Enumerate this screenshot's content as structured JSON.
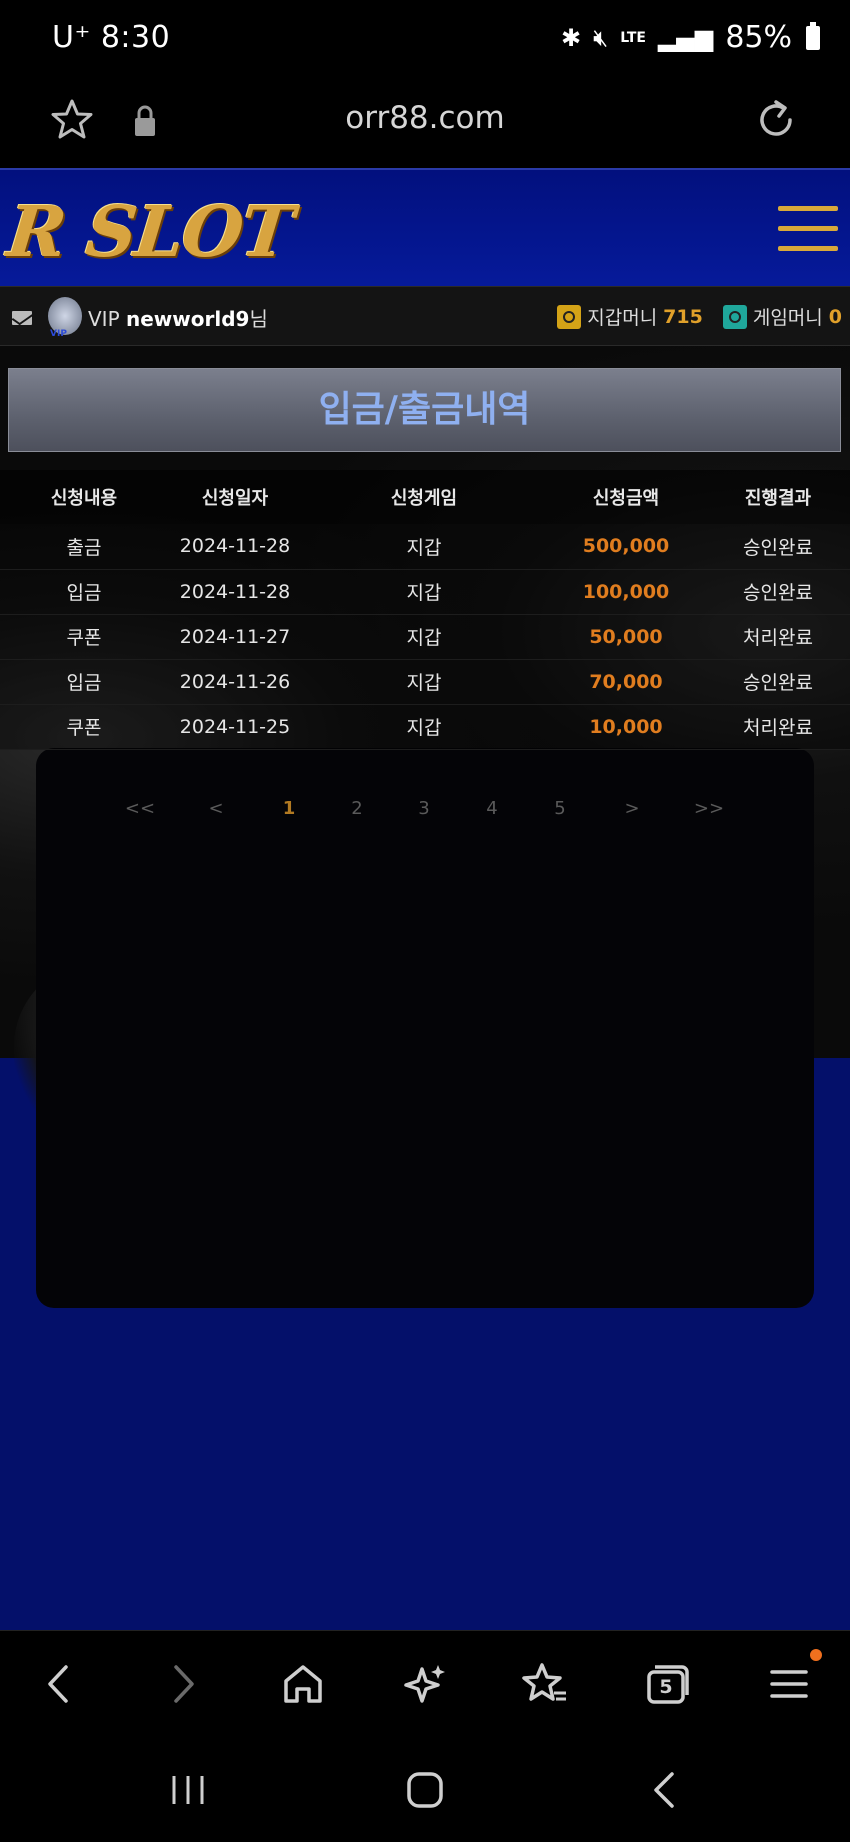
{
  "status_bar": {
    "carrier_time": "U⁺ 8:30",
    "network": "LTE",
    "battery": "85%"
  },
  "browser": {
    "url": "orr88.com",
    "tab_count": "5"
  },
  "site": {
    "logo": "R SLOT",
    "user": {
      "level": "VIP",
      "username": "newworld9",
      "suffix": "님",
      "wallet_label": "지갑머니",
      "wallet_amount": "715",
      "game_label": "게임머니",
      "game_amount": "0"
    },
    "page_title": "입금/출금내역",
    "table": {
      "headers": [
        "신청내용",
        "신청일자",
        "신청게임",
        "신청금액",
        "진행결과"
      ],
      "rows": [
        [
          "출금",
          "2024-11-28",
          "지갑",
          "500,000",
          "승인완료"
        ],
        [
          "입금",
          "2024-11-28",
          "지갑",
          "100,000",
          "승인완료"
        ],
        [
          "쿠폰",
          "2024-11-27",
          "지갑",
          "50,000",
          "처리완료"
        ],
        [
          "입금",
          "2024-11-26",
          "지갑",
          "70,000",
          "승인완료"
        ],
        [
          "쿠폰",
          "2024-11-25",
          "지갑",
          "10,000",
          "처리완료"
        ]
      ]
    },
    "pagination": {
      "first": "<<",
      "prev": "<",
      "pages": [
        "1",
        "2",
        "3",
        "4",
        "5"
      ],
      "current": "1",
      "next": ">",
      "last": ">>"
    }
  },
  "colors": {
    "brand_blue": "#04106a",
    "accent_gold": "#d9a93a",
    "amount_orange": "#e07d1f",
    "title_text": "#8fb0f0"
  }
}
